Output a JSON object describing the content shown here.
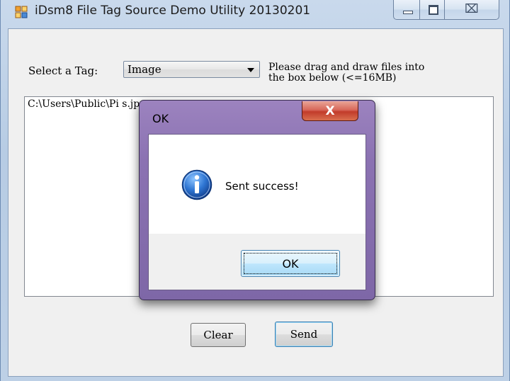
{
  "window": {
    "title": "iDsm8 File Tag Source Demo Utility 20130201",
    "close_glyph": "⌧"
  },
  "form": {
    "tag_label": "Select a Tag:",
    "tag_selected": "Image",
    "hint_line1": "Please drag and draw files into",
    "hint_line2": "the box below (<=16MB)",
    "file_path": "C:\\Users\\Public\\Pi                                     s.jpg",
    "clear_label": "Clear",
    "send_label": "Send"
  },
  "dialog": {
    "title": "OK",
    "close_glyph": "X",
    "message": "Sent success!",
    "ok_label": "OK"
  },
  "colors": {
    "accent": "#3c7fb1",
    "info_icon": "#1f5fb8",
    "dialog_frame": "#8b72b2",
    "close_red": "#c23b2a"
  }
}
